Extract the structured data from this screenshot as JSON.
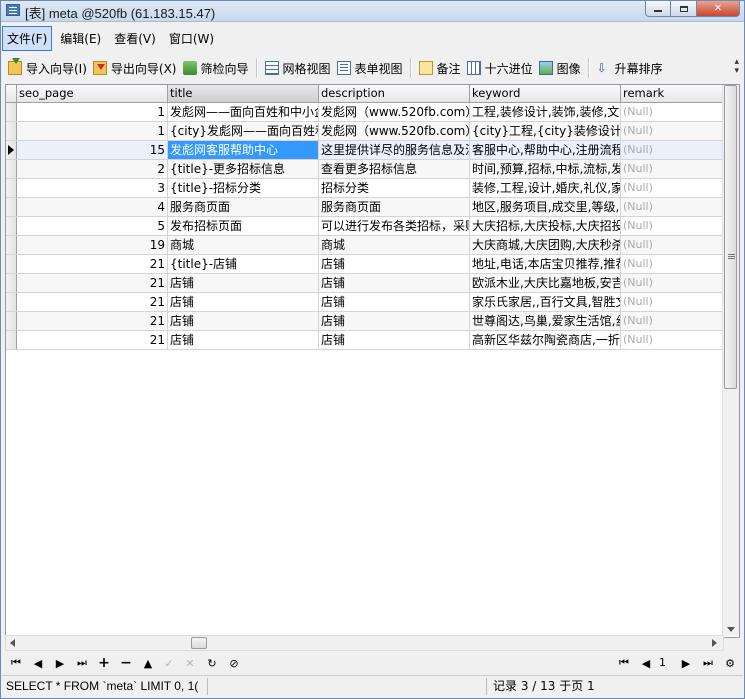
{
  "window": {
    "title": "[表] meta @520fb (61.183.15.47)"
  },
  "menu": [
    {
      "label": "文件(F)",
      "active": true
    },
    {
      "label": "编辑(E)"
    },
    {
      "label": "查看(V)"
    },
    {
      "label": "窗口(W)"
    }
  ],
  "toolbar": {
    "import": "导入向导(I)",
    "export": "导出向导(X)",
    "filter": "筛检向导",
    "grid_view": "网格视图",
    "form_view": "表单视图",
    "memo": "备注",
    "hex": "十六进位",
    "image": "图像",
    "sort_asc": "升幕排序"
  },
  "columns": [
    "seo_page",
    "title",
    "description",
    "keyword",
    "remark"
  ],
  "rows": [
    {
      "seo_page": "1",
      "title": "发彪网——面向百姓和中小企",
      "description": "发彪网（www.520fb.com）是",
      "keyword": "工程,装修设计,装饰,装修,文",
      "remark": "(Null)"
    },
    {
      "seo_page": "1",
      "title": "{city}发彪网——面向百姓和中",
      "description": "发彪网（www.520fb.com）是",
      "keyword": "{city}工程,{city}装修设计,{ci",
      "remark": "(Null)"
    },
    {
      "seo_page": "15",
      "title": "发彪网客服帮助中心",
      "description": "这里提供详尽的服务信息及注",
      "keyword": "客服中心,帮助中心,注册流程",
      "remark": "(Null)"
    },
    {
      "seo_page": "2",
      "title": "{title}-更多招标信息",
      "description": "查看更多招标信息",
      "keyword": "时间,预算,招标,中标,流标,发",
      "remark": "(Null)"
    },
    {
      "seo_page": "3",
      "title": "{title}-招标分类",
      "description": "招标分类",
      "keyword": "装修,工程,设计,婚庆,礼仪,家",
      "remark": "(Null)"
    },
    {
      "seo_page": "4",
      "title": "服务商页面",
      "description": "服务商页面",
      "keyword": "地区,服务项目,成交里,等级,",
      "remark": "(Null)"
    },
    {
      "seo_page": "5",
      "title": "发布招标页面",
      "description": "可以进行发布各类招标，采购",
      "keyword": "大庆招标,大庆投标,大庆招投",
      "remark": "(Null)"
    },
    {
      "seo_page": "19",
      "title": "商城",
      "description": "商城",
      "keyword": "大庆商城,大庆团购,大庆秒杀",
      "remark": "(Null)"
    },
    {
      "seo_page": "21",
      "title": "{title}-店铺",
      "description": "店铺",
      "keyword": "地址,电话,本店宝贝推荐,推荐",
      "remark": "(Null)"
    },
    {
      "seo_page": "21",
      "title": "店铺",
      "description": "店铺",
      "keyword": "欧派木业,大庆比嘉地板,安吉",
      "remark": "(Null)"
    },
    {
      "seo_page": "21",
      "title": "店铺",
      "description": "店铺",
      "keyword": "家乐氏家居,,百行文具,智胜文",
      "remark": "(Null)"
    },
    {
      "seo_page": "21",
      "title": "店铺",
      "description": "店铺",
      "keyword": "世尊阁达,鸟巢,爱家生活馆,丝",
      "remark": "(Null)"
    },
    {
      "seo_page": "21",
      "title": "店铺",
      "description": "店铺",
      "keyword": "高新区华兹尔陶瓷商店,一折",
      "remark": "(Null)"
    }
  ],
  "current_row_index": 2,
  "selected_column": "title",
  "nav": {
    "page": "1"
  },
  "status": {
    "sql": "SELECT * FROM `meta` LIMIT 0, 1(",
    "record": "记录 3 / 13 于页 1"
  },
  "colors": {
    "selection": "#3399ff",
    "null_text": "#a9a9a9"
  }
}
